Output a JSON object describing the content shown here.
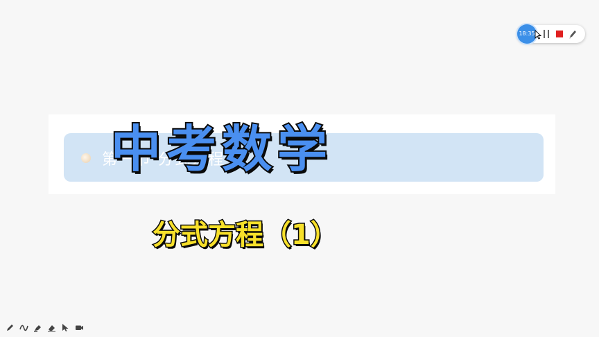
{
  "recorder": {
    "time": "18:35",
    "pause_icon": "pause-icon",
    "stop_icon": "stop-icon",
    "pen_icon": "pen-icon",
    "stop_color": "#e02020",
    "accent": "#3b8fe8"
  },
  "slide": {
    "item_text": "第一节 分式方程",
    "item_bar_color": "#d2e4f5"
  },
  "title": {
    "main": "中考数学",
    "sub": "分式方程（1）",
    "main_color": "#4a8ff0",
    "sub_color": "#f7e02a"
  },
  "toolbar": {
    "tools": [
      "pen-icon",
      "curve-icon",
      "highlighter-icon",
      "eraser-icon",
      "pointer-icon",
      "camera-icon"
    ]
  }
}
